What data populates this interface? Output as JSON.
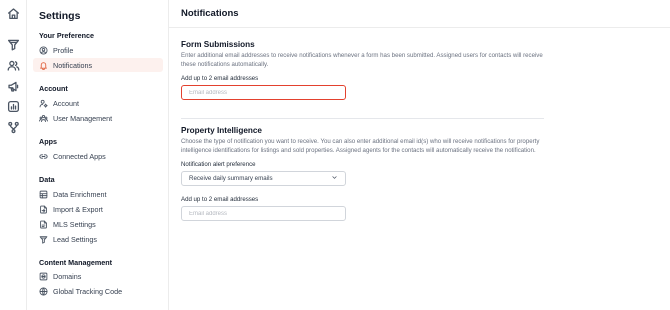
{
  "rail": {
    "icons": [
      "home-icon",
      "funnel-icon",
      "users-icon",
      "megaphone-icon",
      "chart-icon",
      "branch-icon"
    ]
  },
  "sidebar": {
    "title": "Settings",
    "sections": [
      {
        "title": "Your Preference",
        "items": [
          {
            "label": "Profile",
            "icon": "user-circle-icon",
            "active": false
          },
          {
            "label": "Notifications",
            "icon": "bell-icon",
            "active": true
          }
        ]
      },
      {
        "title": "Account",
        "items": [
          {
            "label": "Account",
            "icon": "user-gear-icon",
            "active": false
          },
          {
            "label": "User Management",
            "icon": "users-icon",
            "active": false
          }
        ]
      },
      {
        "title": "Apps",
        "items": [
          {
            "label": "Connected Apps",
            "icon": "link-icon",
            "active": false
          }
        ]
      },
      {
        "title": "Data",
        "items": [
          {
            "label": "Data Enrichment",
            "icon": "database-icon",
            "active": false
          },
          {
            "label": "Import & Export",
            "icon": "file-import-icon",
            "active": false
          },
          {
            "label": "MLS Settings",
            "icon": "document-icon",
            "active": false
          },
          {
            "label": "Lead Settings",
            "icon": "filter-icon",
            "active": false
          }
        ]
      },
      {
        "title": "Content Management",
        "items": [
          {
            "label": "Domains",
            "icon": "domain-icon",
            "active": false
          },
          {
            "label": "Global Tracking Code",
            "icon": "globe-icon",
            "active": false
          }
        ]
      }
    ]
  },
  "main": {
    "title": "Notifications",
    "form_submissions": {
      "heading": "Form Submissions",
      "description": "Enter additional email addresses to receive notifications whenever a form has been submitted. Assigned users for contacts will receive these notifications automatically.",
      "email_label": "Add up to 2 email addresses",
      "email_placeholder": "Email address",
      "email_value": ""
    },
    "property_intelligence": {
      "heading": "Property Intelligence",
      "description": "Choose the type of notification you want to receive. You can also enter additional email id(s) who will receive notifications for property intelligence identifications for listings and sold properties. Assigned agents for the contacts will automatically receive the notification.",
      "alert_label": "Notification alert preference",
      "alert_value": "Receive daily summary emails",
      "email_label": "Add up to 2 email addresses",
      "email_placeholder": "Email address",
      "email_value": ""
    }
  },
  "colors": {
    "accent": "#e0633f",
    "active_bg": "#fdf1ee",
    "focus_border": "#e3412e"
  }
}
